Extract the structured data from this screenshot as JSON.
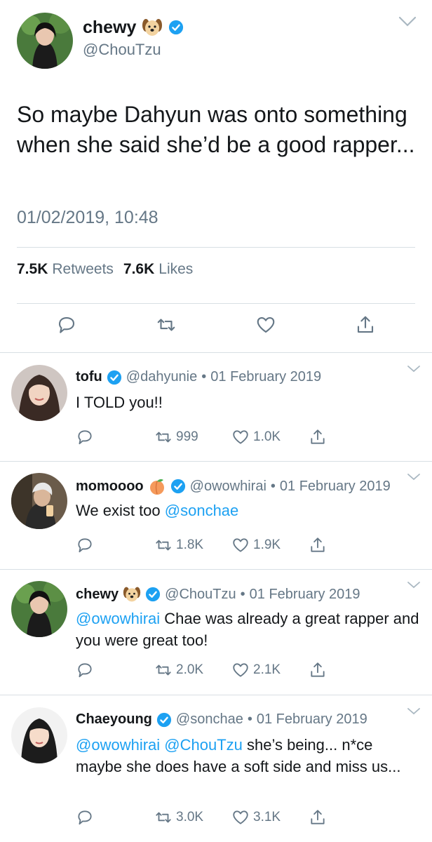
{
  "main_tweet": {
    "name": "chewy",
    "handle": "@ChouTzu",
    "text": "So maybe Dahyun was onto something when she said she’d be a good rapper...",
    "timestamp": "01/02/2019, 10:48",
    "retweets_count": "7.5K",
    "retweets_label": "Retweets",
    "likes_count": "7.6K",
    "likes_label": "Likes"
  },
  "replies": [
    {
      "name": "tofu",
      "handle": "@dahyunie",
      "separator": "•",
      "date": "01 February 2019",
      "text_plain": "I TOLD you!!",
      "retweets": "999",
      "likes": "1.0K"
    },
    {
      "name": "momoooo",
      "handle": "@owowhirai",
      "separator": "•",
      "date": "01 February 2019",
      "text_plain": "We exist too ",
      "mention": "@sonchae",
      "retweets": "1.8K",
      "likes": "1.9K"
    },
    {
      "name": "chewy",
      "handle": "@ChouTzu",
      "separator": "•",
      "date": "01 February 2019",
      "mention": "@owowhirai",
      "text_plain": " Chae was already a great rapper and you were great too!",
      "retweets": "2.0K",
      "likes": "2.1K"
    },
    {
      "name": "Chaeyoung",
      "handle": "@sonchae",
      "separator": "•",
      "date": "01 February 2019",
      "mention1": "@owowhirai",
      "mention2": "@ChouTzu",
      "text_plain": " she’s being... n*ce maybe she does have a soft side and miss us...",
      "retweets": "3.0K",
      "likes": "3.1K"
    }
  ],
  "colors": {
    "text": "#14171a",
    "secondary": "#657786",
    "link": "#1da1f2",
    "divider": "#d8dfe4"
  },
  "icons": [
    "verified-badge-icon",
    "dog-emoji-icon",
    "peach-emoji-icon",
    "reply-icon",
    "retweet-icon",
    "like-icon",
    "share-icon",
    "chevron-down-icon"
  ]
}
